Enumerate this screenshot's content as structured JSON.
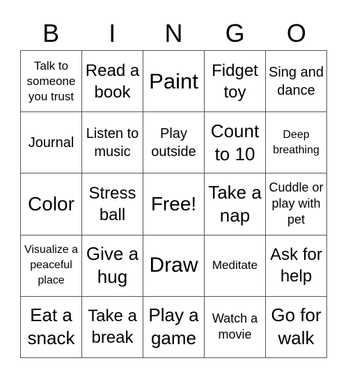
{
  "header": {
    "letters": [
      "B",
      "I",
      "N",
      "G",
      "O"
    ]
  },
  "cells": [
    [
      "Talk to someone you trust",
      "Read a book",
      "Paint",
      "Fidget toy",
      "Sing and dance"
    ],
    [
      "Journal",
      "Listen to music",
      "Play outside",
      "Count to 10",
      "Deep breathing"
    ],
    [
      "Color",
      "Stress ball",
      "Free!",
      "Take a nap",
      "Cuddle or play with pet"
    ],
    [
      "Visualize a peaceful place",
      "Give a hug",
      "Draw",
      "Meditate",
      "Ask for help"
    ],
    [
      "Eat a snack",
      "Take a break",
      "Play a game",
      "Watch a movie",
      "Go for walk"
    ]
  ],
  "free_space": "Free!"
}
